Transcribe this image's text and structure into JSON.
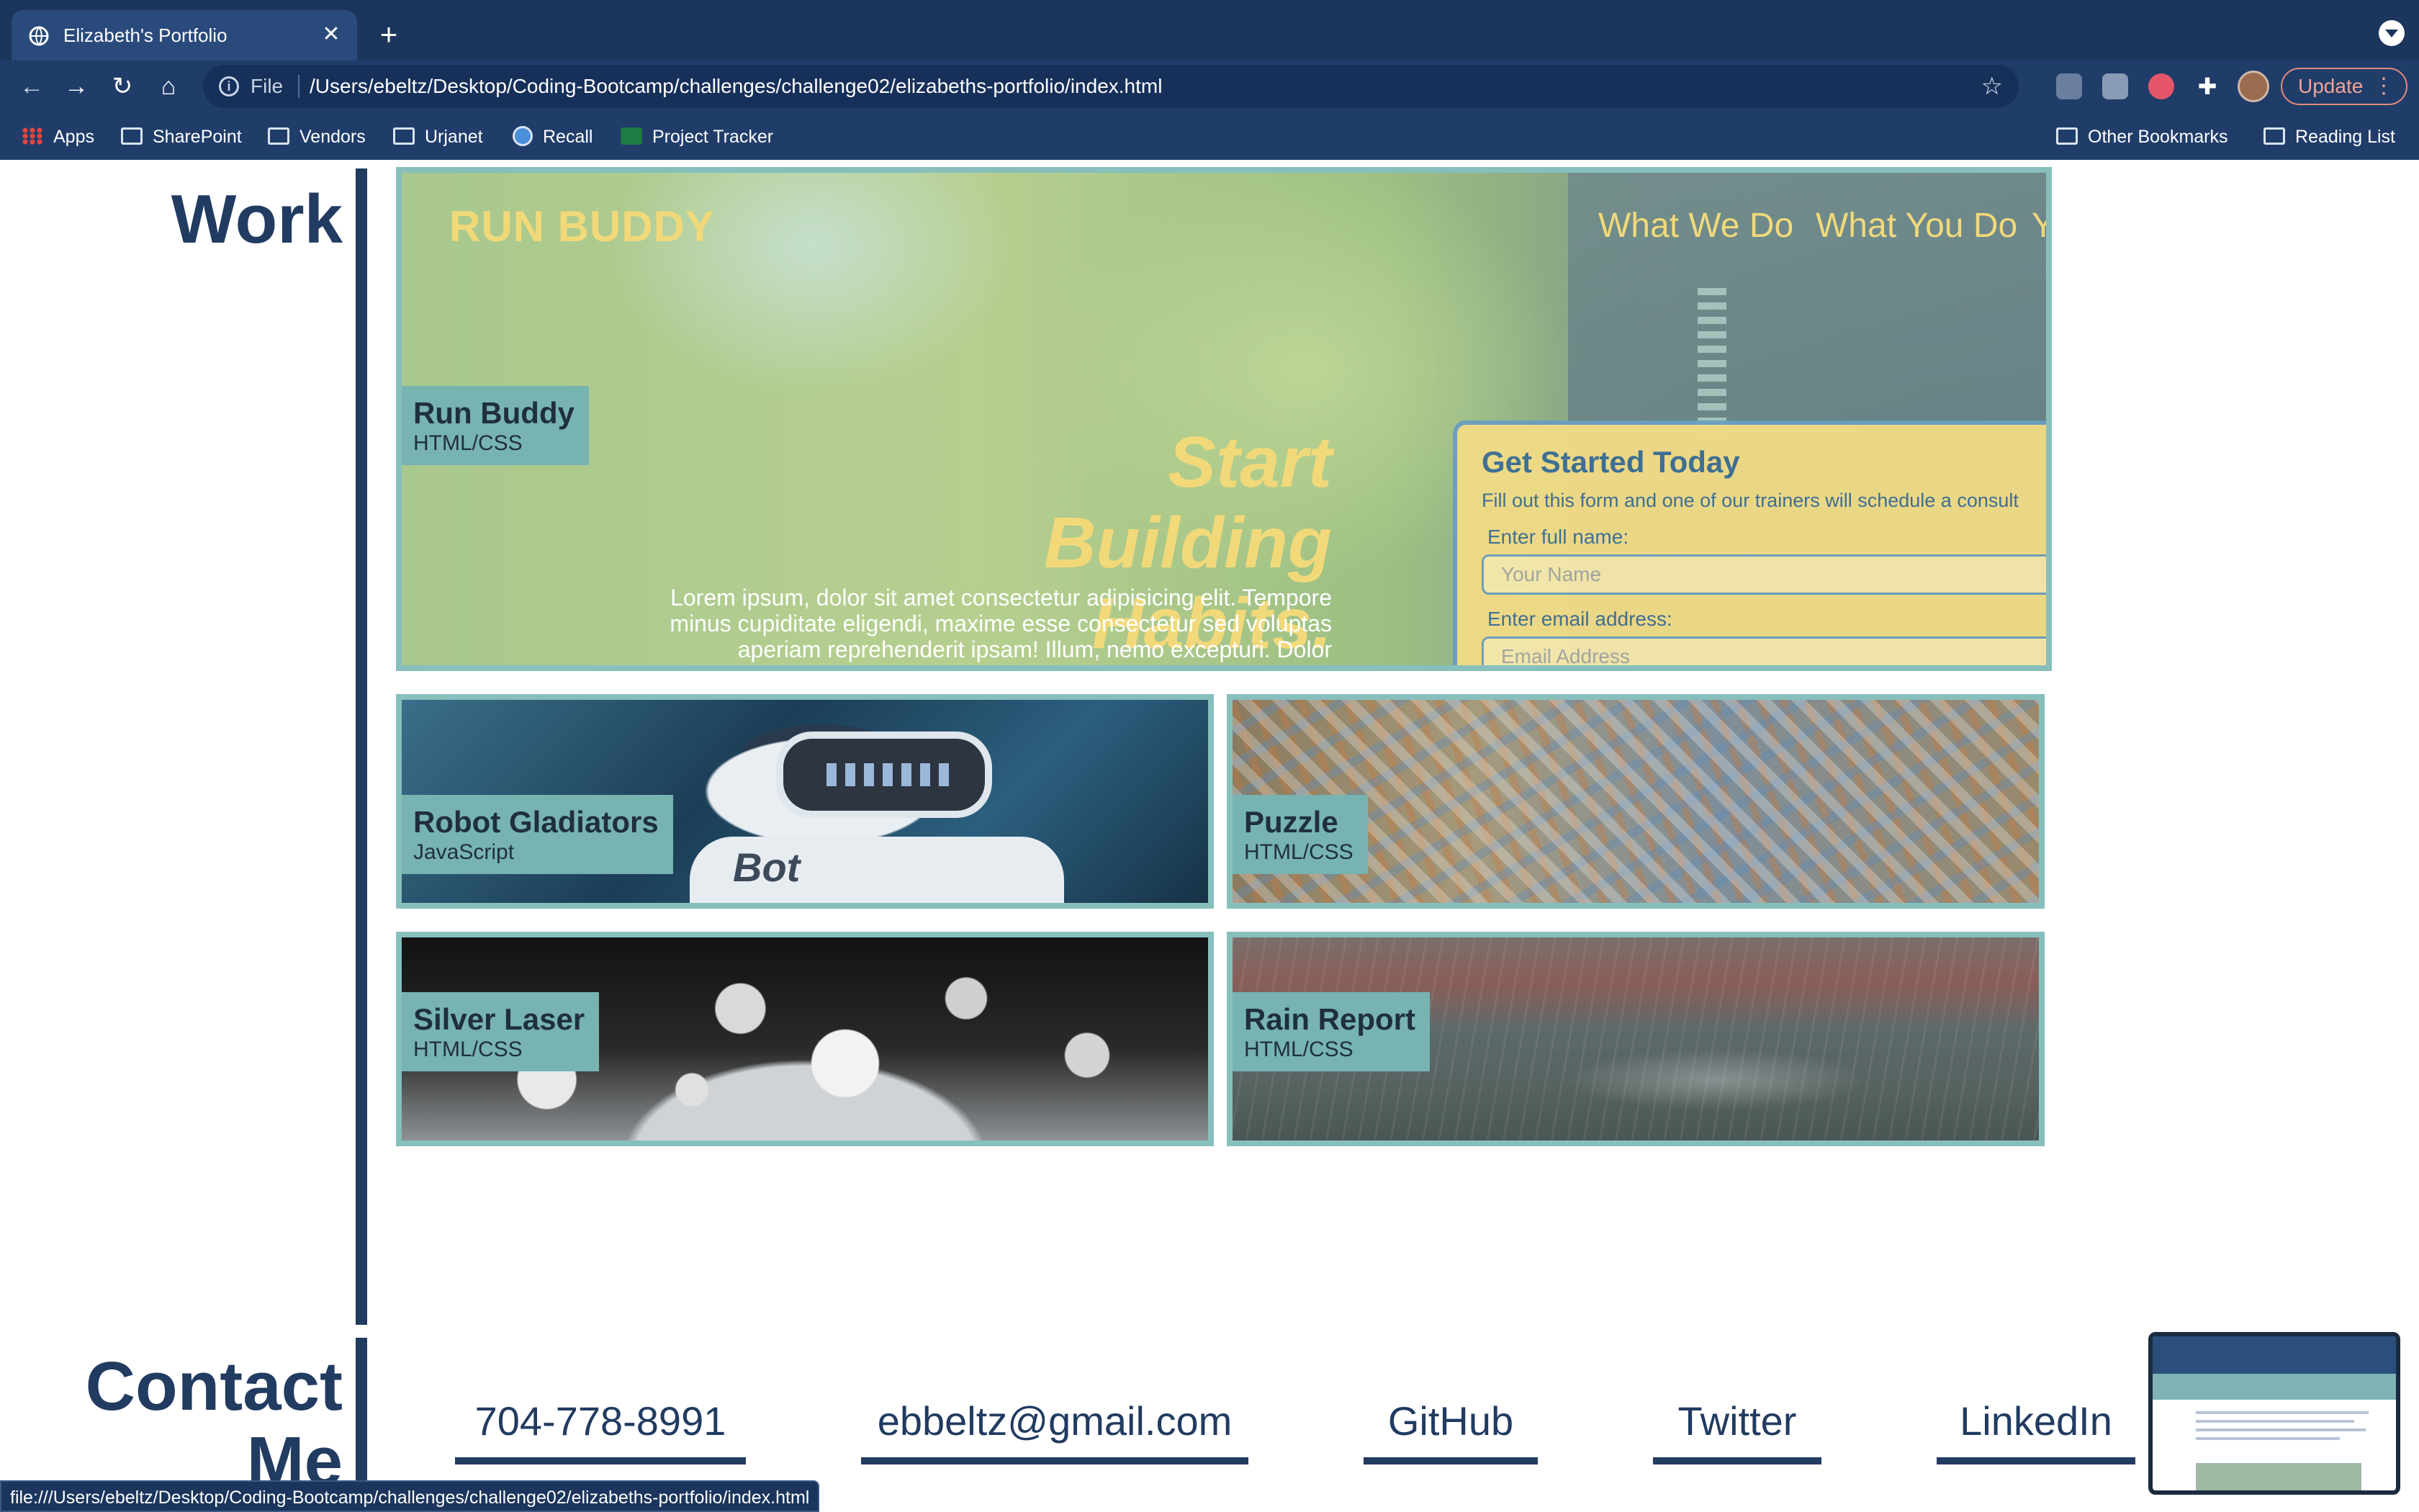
{
  "browser": {
    "tab_title": "Elizabeth's Portfolio",
    "tab_close": "✕",
    "new_tab": "+",
    "url_scheme": "File",
    "url": "/Users/ebeltz/Desktop/Coding-Bootcamp/challenges/challenge02/elizabeths-portfolio/index.html",
    "update_label": "Update",
    "bookmarks": [
      "Apps",
      "SharePoint",
      "Vendors",
      "Urjanet",
      "Recall",
      "Project Tracker"
    ],
    "other_bookmarks": "Other Bookmarks",
    "reading_list": "Reading List",
    "status_url": "file:///Users/ebeltz/Desktop/Coding-Bootcamp/challenges/challenge02/elizabeths-portfolio/index.html",
    "accent": "#203d6a"
  },
  "work": {
    "title": "Work",
    "featured": {
      "name": "Run Buddy",
      "tech": "HTML/CSS",
      "preview": {
        "brand": "RUN BUDDY",
        "nav": [
          "What We Do",
          "What You Do",
          "Y"
        ],
        "headline": "Start Building Habits.",
        "body": "Lorem ipsum, dolor sit amet consectetur adipisicing elit. Tempore minus cupiditate eligendi, maxime esse consectetur sed voluptas aperiam reprehenderit ipsam! Illum, nemo excepturi. Dolor debitis",
        "form_title": "Get Started Today",
        "form_subtitle": "Fill out this form and one of our trainers will schedule a consult",
        "name_label": "Enter full name:",
        "name_placeholder": "Your Name",
        "email_label": "Enter email address:",
        "email_placeholder": "Email Address"
      }
    },
    "projects": [
      {
        "name": "Robot Gladiators",
        "tech": "JavaScript",
        "image_text": "Bot"
      },
      {
        "name": "Puzzle",
        "tech": "HTML/CSS"
      },
      {
        "name": "Silver Laser",
        "tech": "HTML/CSS"
      },
      {
        "name": "Rain Report",
        "tech": "HTML/CSS"
      }
    ]
  },
  "contact": {
    "title": "Contact Me",
    "phone": "704-778-8991",
    "email": "ebbeltz@gmail.com",
    "github": "GitHub",
    "twitter": "Twitter",
    "linkedin": "LinkedIn"
  }
}
